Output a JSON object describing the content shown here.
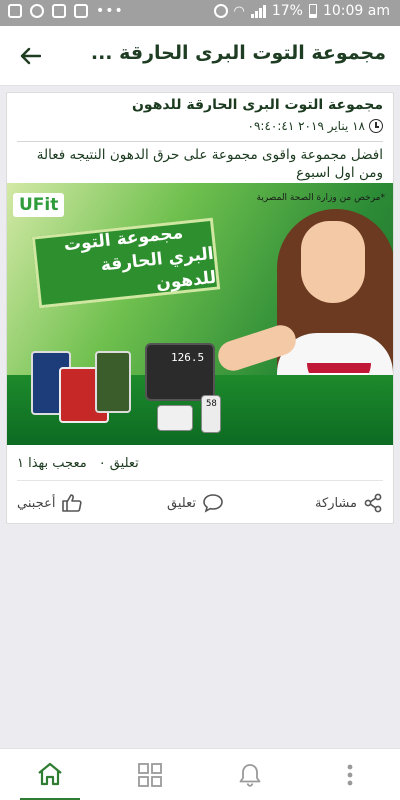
{
  "status_bar": {
    "battery": "17%",
    "time": "10:09 am"
  },
  "app_bar": {
    "title": "مجموعة التوت البرى الحارقة ..."
  },
  "post": {
    "title": "مجموعة التوت البرى الحارقة للدهون",
    "date": "١٨ يناير ٢٠١٩ ٠٩:٤٠:٤١",
    "body": "افضل مجموعة واقوى مجموعة على حرق الدهون النتيجه فعالة ومن اول اسبوع",
    "banner": {
      "brand": "UFit",
      "ministry": "*مرخص من وزارة الصحة المصرية",
      "headline_line1": "مجموعة التوت",
      "headline_line2": "البري الحارقة للدهون",
      "scale_reading": "126.5",
      "meter_reading": "58"
    },
    "stats": {
      "likes": "معجب بهذا ١",
      "comments": "تعليق ٠"
    },
    "actions": {
      "share": "مشاركة",
      "comment": "تعليق",
      "like": "أعجبني"
    }
  },
  "colors": {
    "primary": "#2e7d32",
    "title_text": "#1e3d23"
  },
  "bottom_nav": {
    "items": [
      "home-icon",
      "grid-icon",
      "bell-icon",
      "more-icon"
    ],
    "active": "home-icon"
  }
}
